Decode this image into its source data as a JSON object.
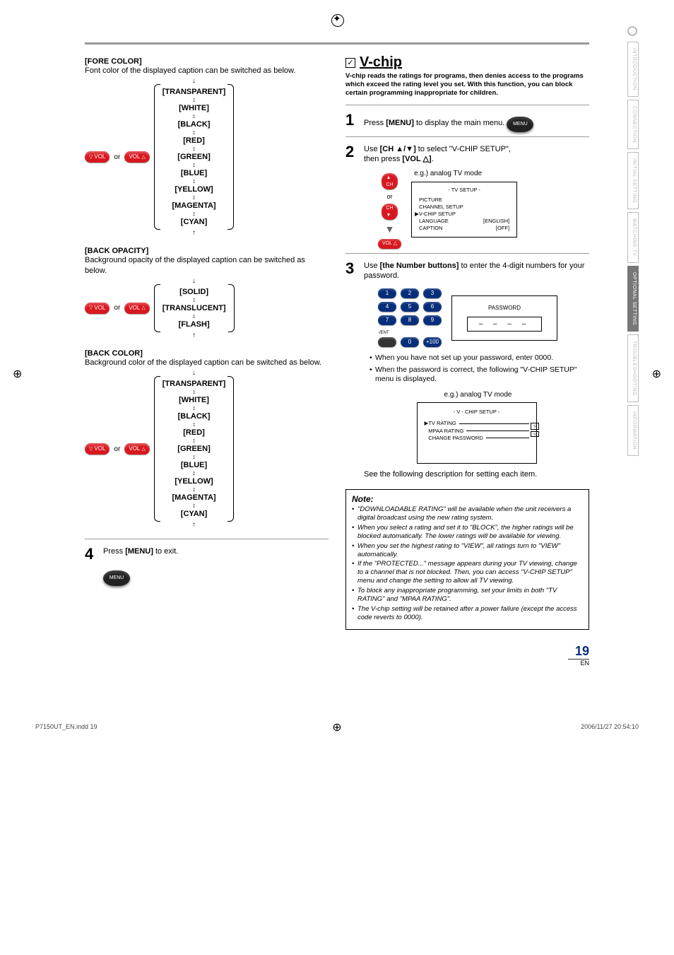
{
  "tabs": [
    "INTRODUCTION",
    "CONNECTION",
    "INITIAL SETTING",
    "WATCHING TV",
    "OPTIONAL SETTING",
    "TROUBLESHOOTING",
    "INFORMATION"
  ],
  "activeTabIndex": 4,
  "left": {
    "foreColor": {
      "heading": "[FORE COLOR]",
      "desc": "Font color of the displayed caption can be switched as below.",
      "options": [
        "[TRANSPARENT]",
        "[WHITE]",
        "[BLACK]",
        "[RED]",
        "[GREEN]",
        "[BLUE]",
        "[YELLOW]",
        "[MAGENTA]",
        "[CYAN]"
      ]
    },
    "backOpacity": {
      "heading": "[BACK OPACITY]",
      "desc": "Background opacity of the displayed caption can be switched as below.",
      "options": [
        "[SOLID]",
        "[TRANSLUCENT]",
        "[FLASH]"
      ]
    },
    "backColor": {
      "heading": "[BACK COLOR]",
      "desc": "Background color of the displayed caption can be switched as below.",
      "options": [
        "[TRANSPARENT]",
        "[WHITE]",
        "[BLACK]",
        "[RED]",
        "[GREEN]",
        "[BLUE]",
        "[YELLOW]",
        "[MAGENTA]",
        "[CYAN]"
      ]
    },
    "remote": {
      "volDown": "VOL",
      "or": "or",
      "volUp": "VOL"
    },
    "step4": {
      "num": "4",
      "textPrefix": "Press ",
      "textBold": "[MENU]",
      "textSuffix": " to exit."
    },
    "menuBtn": "MENU"
  },
  "right": {
    "title": "V-chip",
    "desc": "V-chip reads the ratings for programs, then denies access to the programs which exceed the rating level you set. With this function, you can block certain programming inappropriate for children.",
    "step1": {
      "num": "1",
      "prefix": "Press ",
      "bold": "[MENU]",
      "suffix": " to display the main menu."
    },
    "step2": {
      "num": "2",
      "line1_prefix": "Use ",
      "line1_bold": "[CH ▲/▼]",
      "line1_suffix": " to select \"V-CHIP SETUP\",",
      "line2_prefix": "then press ",
      "line2_bold": "[VOL △]",
      "line2_suffix": ".",
      "eg": "e.g.) analog TV mode",
      "chUp": "CH",
      "or": "or",
      "chDown": "CH",
      "volUp": "VOL △",
      "screen": {
        "title": "- TV SETUP -",
        "rows": [
          {
            "label": "PICTURE",
            "value": ""
          },
          {
            "label": "CHANNEL SETUP",
            "value": ""
          },
          {
            "label": "V-CHIP SETUP",
            "value": "",
            "pointer": true
          },
          {
            "label": "LANGUAGE",
            "value": "[ENGLISH]"
          },
          {
            "label": "CAPTION",
            "value": "[OFF]"
          }
        ]
      }
    },
    "step3": {
      "num": "3",
      "prefix": "Use ",
      "bold": "[the Number buttons]",
      "suffix": " to enter the 4-digit numbers for your password.",
      "nums": [
        "1",
        "2",
        "3",
        "4",
        "5",
        "6",
        "7",
        "8",
        "9",
        "",
        "0",
        "+100"
      ],
      "entLabel": "-/ENT",
      "pw": {
        "title": "PASSWORD",
        "mask": "– – – –"
      },
      "bullets": [
        "When you have not set up your password, enter 0000.",
        "When the password is correct, the following \"V-CHIP SETUP\" menu is displayed."
      ],
      "eg": "e.g.) analog TV mode",
      "vchipScreen": {
        "title": "- V - CHIP SETUP -",
        "row1": "TV RATING",
        "row2": "MPAA RATING",
        "row3": "CHANGE PASSWORD",
        "side": [
          "ঢ়া",
          "ঢ়"
        ]
      },
      "closing": "See the following description for setting each item."
    },
    "note": {
      "title": "Note:",
      "items": [
        "\"DOWNLOADABLE RATING\" will be available when the unit receivers a digital broadcast using the new rating system.",
        "When you select a rating and set it to \"BLOCK\", the higher ratings will be blocked automatically. The lower ratings will be available for viewing.",
        "When you set the highest rating to \"VIEW\", all ratings turn to \"VIEW\" automatically.",
        "If the \"PROTECTED...\" message appears during your TV viewing, change to a channel that is not blocked. Then, you can access \"V-CHIP SETUP\" menu and change the setting to allow all TV viewing.",
        "To block any inappropriate programming, set your limits in both \"TV RATING\" and \"MPAA RATING\".",
        "The V-chip setting will be retained after a power failure (except the access code reverts to 0000)."
      ]
    }
  },
  "page": {
    "num": "19",
    "en": "EN"
  },
  "footer": {
    "left": "P7150UT_EN.indd   19",
    "right": "2006/11/27   20:54:10"
  }
}
